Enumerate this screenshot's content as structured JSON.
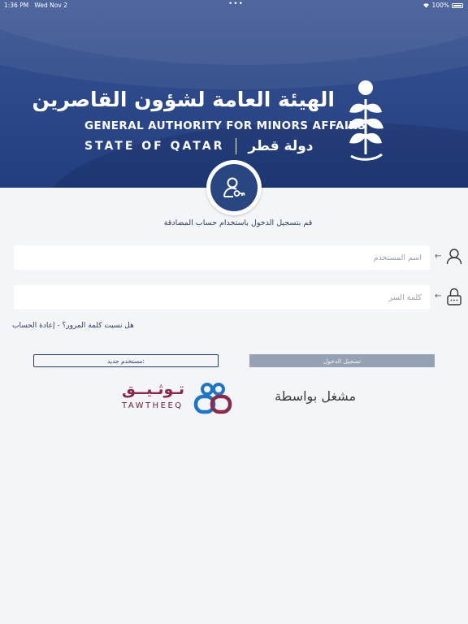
{
  "status_bar": {
    "time": "1:36 PM",
    "date": "Wed Nov 2",
    "dots": "•••",
    "battery": "100%"
  },
  "header": {
    "arabic_title": "الهيئة العامة لشؤون القاصرين",
    "english_title": "GENERAL AUTHORITY FOR MINORS AFFAIRS",
    "state_en": "STATE OF QATAR",
    "state_ar": "دولة قطر",
    "icons": {
      "emblem": "palm-leaf-emblem-icon",
      "avatar": "user-key-icon"
    }
  },
  "login": {
    "instruction": "قم بتسجيل الدخول باستخدام حساب المصادقة",
    "username_placeholder": "اسم المستخدم",
    "password_placeholder": "كلمة السر",
    "forgot_text": "هل نسيت كلمة المرور؟ - إعادة الحساب",
    "login_button": "تسجيل الدخول",
    "new_user_button": "مستخدم جديد:",
    "arrow": "←"
  },
  "footer": {
    "powered_by": "مشغل بواسطة",
    "brand_ar": "تـوثـيــق",
    "brand_en": "TAWTHEEQ"
  },
  "colors": {
    "header_blue": "#2e4a8a",
    "avatar_blue": "#2a4680",
    "login_button": "#96a1b4",
    "brand_maroon": "#8a2a4a",
    "brand_blue": "#1f74c4"
  }
}
